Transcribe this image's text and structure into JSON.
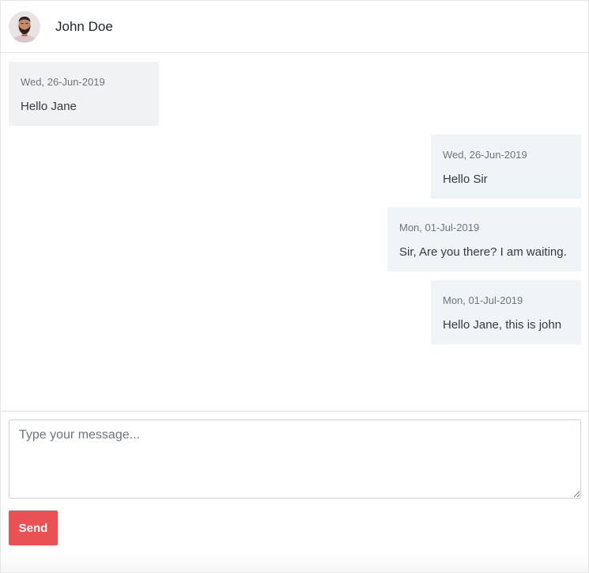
{
  "header": {
    "contact_name": "John Doe",
    "avatar_icon": "user-avatar-photo"
  },
  "messages": [
    {
      "direction": "incoming",
      "date": "Wed, 26-Jun-2019",
      "text": "Hello Jane"
    },
    {
      "direction": "outgoing",
      "date": "Wed, 26-Jun-2019",
      "text": "Hello Sir"
    },
    {
      "direction": "outgoing",
      "date": "Mon, 01-Jul-2019",
      "text": "Sir, Are you there? I am waiting."
    },
    {
      "direction": "outgoing",
      "date": "Mon, 01-Jul-2019",
      "text": "Hello Jane, this is john"
    }
  ],
  "composer": {
    "placeholder": "Type your message...",
    "value": "",
    "send_label": "Send"
  },
  "colors": {
    "send_button": "#ea5155",
    "incoming_bubble": "#f1f2f4",
    "outgoing_bubble": "#eff4f7"
  }
}
